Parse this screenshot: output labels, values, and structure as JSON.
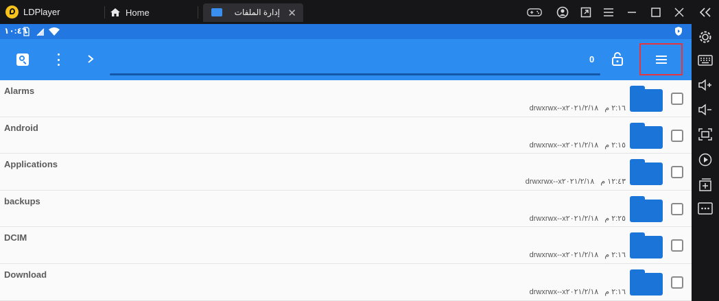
{
  "titlebar": {
    "app_name": "LDPlayer",
    "tabs": [
      {
        "label": "Home",
        "icon": "home-icon"
      },
      {
        "label": "إدارة الملفات",
        "icon": "folder-icon"
      }
    ],
    "controls": [
      "gamepad-icon",
      "account-icon",
      "restore-icon",
      "menu-icon",
      "minimize-icon",
      "maximize-icon",
      "close-icon"
    ]
  },
  "statusbar": {
    "time": "١٠:٤٦",
    "icons": [
      "sim-icon",
      "battery-icon",
      "signal-icon",
      "wifi-icon",
      "shield-icon"
    ]
  },
  "toolbar": {
    "count": "0",
    "icons": [
      "search-icon",
      "more-vert-icon",
      "chevron-right-icon",
      "lock-icon",
      "hamburger-menu-icon"
    ]
  },
  "files": [
    {
      "name": "Alarms",
      "permissions": "drwxrwx--x",
      "date": "٢٠٢١/٢/١٨",
      "time": "٢:١٦ م"
    },
    {
      "name": "Android",
      "permissions": "drwxrwx--x",
      "date": "٢٠٢١/٢/١٨",
      "time": "٢:١٥ م"
    },
    {
      "name": "Applications",
      "permissions": "drwxrwx--x",
      "date": "٢٠٢١/٢/١٨",
      "time": "١٢:٤٣ م"
    },
    {
      "name": "backups",
      "permissions": "drwxrwx--x",
      "date": "٢٠٢١/٢/١٨",
      "time": "٢:٢٥ م"
    },
    {
      "name": "DCIM",
      "permissions": "drwxrwx--x",
      "date": "٢٠٢١/٢/١٨",
      "time": "٢:١٦ م"
    },
    {
      "name": "Download",
      "permissions": "drwxrwx--x",
      "date": "٢٠٢١/٢/١٨",
      "time": "٢:١٦ م"
    }
  ],
  "sidebar": {
    "icons": [
      "collapse-icon",
      "settings-icon",
      "keyboard-icon",
      "volume-up-icon",
      "volume-down-icon",
      "screen-resize-icon",
      "record-icon",
      "add-instance-icon",
      "more-icon"
    ]
  },
  "colors": {
    "statusbar": "#2277e0",
    "toolbar": "#2d8cf0",
    "folder": "#1b74d8",
    "highlight": "#e8353b"
  }
}
